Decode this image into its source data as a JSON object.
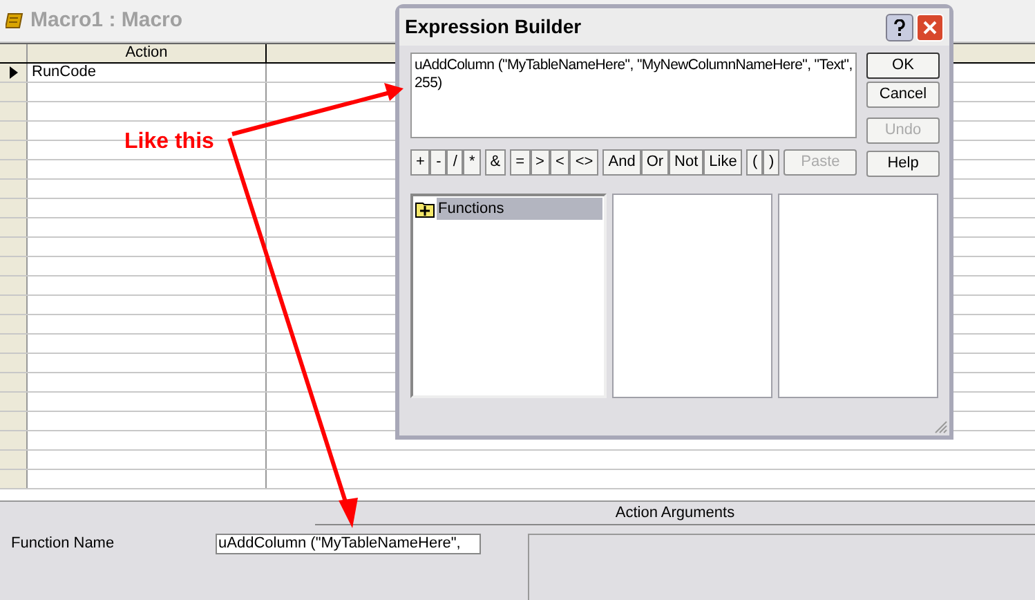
{
  "window": {
    "title": "Macro1 : Macro"
  },
  "grid": {
    "columns": [
      "Action"
    ],
    "rows": [
      {
        "action": "RunCode",
        "current": true
      }
    ]
  },
  "action_arguments": {
    "title": "Action Arguments",
    "fields": [
      {
        "label": "Function Name",
        "value": "uAddColumn (\"MyTableNameHere\","
      }
    ]
  },
  "dialog": {
    "title": "Expression Builder",
    "expression": "uAddColumn (\"MyTableNameHere\", \"MyNewColumnNameHere\", \"Text\", 255)",
    "buttons": [
      {
        "label": "OK",
        "disabled": false,
        "default": true
      },
      {
        "label": "Cancel",
        "disabled": false,
        "default": false
      },
      {
        "label": "Undo",
        "disabled": true,
        "default": false
      },
      {
        "label": "Help",
        "disabled": false,
        "default": false
      }
    ],
    "operator_groups": [
      [
        "+",
        "-",
        "/",
        "*"
      ],
      [
        "&"
      ],
      [
        "=",
        ">",
        "<",
        "<>"
      ],
      [
        "And",
        "Or",
        "Not",
        "Like"
      ],
      [
        "(",
        ")"
      ]
    ],
    "paste_button": {
      "label": "Paste",
      "disabled": true
    },
    "tree": [
      {
        "label": "Functions",
        "selected": true,
        "expanded": false
      }
    ]
  },
  "annotation": {
    "label": "Like this"
  }
}
